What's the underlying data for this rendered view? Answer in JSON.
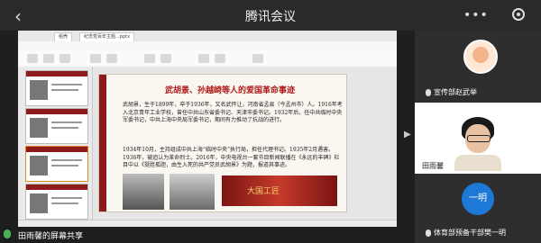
{
  "topbar": {
    "title": "腾讯会议",
    "more": "•••"
  },
  "wps": {
    "tabs": [
      "稻壳",
      "纪念党百年主题...pptx"
    ],
    "menu": [
      "开始",
      "插入",
      "设计",
      "切换",
      "动画",
      "放映",
      "审阅",
      "视图"
    ]
  },
  "slide": {
    "title": "武胡景、孙越崎等人的爱国革命事迹",
    "para1": "武胡景，生于1899年，卒于1936年，又名武怀让，河南省孟县（今孟州市）人。1916年考入北京青年工业学校，曾任中共山东省委书记、天津市委书记。1932年后，任中共临时中央军委书记，中共上海中央局军委书记，期间有力推动了抗战的进行。",
    "para2": "1934年10月，主持组成中共上海“临时中央”执行局，担任代理书记。1935年2月遇害。1936年，被追认为革命烈士。2016年，中央电视台一套节目新闻联播在《永远的丰碑》栏目中以《挺胜孤胆，由生入死的共产党员武胡景》为题，报道其事迹。",
    "photo3_caption": "大国工匠"
  },
  "share_bar": {
    "label": "田雨馨的屏幕共享"
  },
  "participants": [
    {
      "name": "宣传部赵武举",
      "type": "avatar"
    },
    {
      "name": "田雨馨",
      "type": "video"
    },
    {
      "name": "体育部预备干部樊一明",
      "type": "initials",
      "initials": "一明"
    }
  ]
}
